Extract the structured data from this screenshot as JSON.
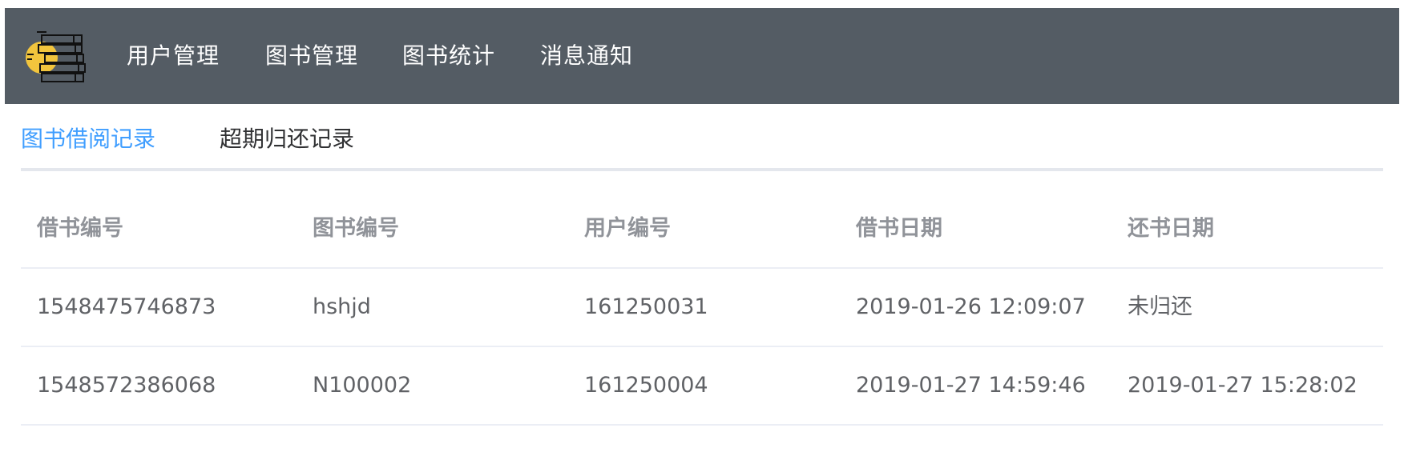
{
  "nav": {
    "items": [
      "用户管理",
      "图书管理",
      "图书统计",
      "消息通知"
    ]
  },
  "tabs": [
    {
      "label": "图书借阅记录",
      "active": true
    },
    {
      "label": "超期归还记录",
      "active": false
    }
  ],
  "table": {
    "headers": [
      "借书编号",
      "图书编号",
      "用户编号",
      "借书日期",
      "还书日期"
    ],
    "rows": [
      [
        "1548475746873",
        "hshjd",
        "161250031",
        "2019-01-26 12:09:07",
        "未归还"
      ],
      [
        "1548572386068",
        "N100002",
        "161250004",
        "2019-01-27 14:59:46",
        "2019-01-27 15:28:02"
      ]
    ]
  },
  "colors": {
    "nav_bg": "#545c64",
    "active_tab": "#409eff",
    "logo_circle": "#f2c53d"
  }
}
